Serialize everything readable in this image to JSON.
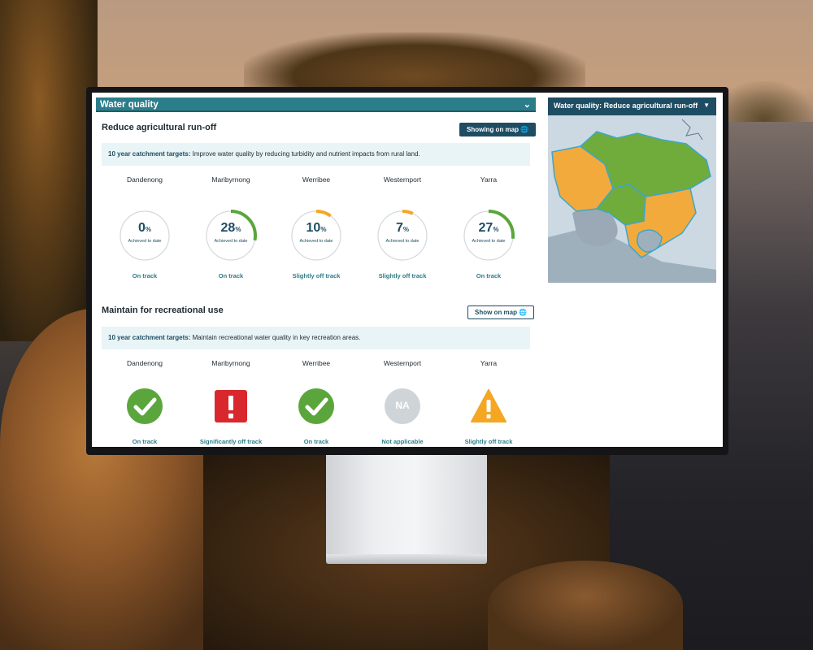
{
  "section": {
    "title": "Water quality"
  },
  "run_off": {
    "title": "Reduce agricultural run-off",
    "map_button": "Showing on map",
    "target_label": "10 year catchment targets:",
    "target_text": "Improve water quality by reducing turbidity and nutrient impacts from rural land.",
    "catchments": [
      {
        "name": "Dandenong",
        "percent": 0,
        "pct_text": "0",
        "achieved": "Achieved to date",
        "status": "On track",
        "ring_color": "#cfd4d8"
      },
      {
        "name": "Maribyrnong",
        "percent": 28,
        "pct_text": "28",
        "achieved": "Achieved to date",
        "status": "On track",
        "ring_color": "#5aa63c"
      },
      {
        "name": "Werribee",
        "percent": 10,
        "pct_text": "10",
        "achieved": "Achieved to date",
        "status": "Slightly off track",
        "ring_color": "#f5a623"
      },
      {
        "name": "Westernport",
        "percent": 7,
        "pct_text": "7",
        "achieved": "Achieved to date",
        "status": "Slightly off track",
        "ring_color": "#f5a623"
      },
      {
        "name": "Yarra",
        "percent": 27,
        "pct_text": "27",
        "achieved": "Achieved to date",
        "status": "On track",
        "ring_color": "#5aa63c"
      }
    ],
    "pct_sign": "%"
  },
  "recreation": {
    "title": "Maintain for recreational use",
    "map_button": "Show on map",
    "target_label": "10 year catchment targets:",
    "target_text": "Maintain recreational water quality in key recreation areas.",
    "catchments": [
      {
        "name": "Dandenong",
        "icon": "check-circle-icon",
        "status": "On track"
      },
      {
        "name": "Maribyrnong",
        "icon": "exclamation-square-icon",
        "status": "Significantly off track"
      },
      {
        "name": "Werribee",
        "icon": "check-circle-icon",
        "status": "On track"
      },
      {
        "name": "Westernport",
        "icon": "na-circle-icon",
        "icon_text": "NA",
        "status": "Not applicable"
      },
      {
        "name": "Yarra",
        "icon": "warning-triangle-icon",
        "status": "Slightly off track"
      }
    ]
  },
  "map_panel": {
    "title": "Water quality: Reduce agricultural run-off"
  },
  "colors": {
    "teal": "#2b7d8a",
    "navy": "#1e4d63",
    "green": "#5aa63c",
    "amber": "#f5a623",
    "red": "#d9272e",
    "grey": "#cfd4d8"
  }
}
